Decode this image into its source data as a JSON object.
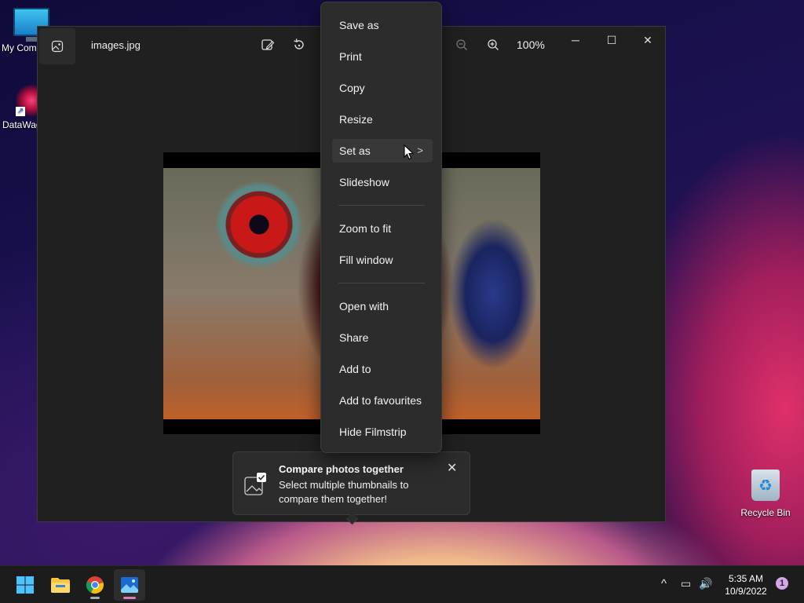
{
  "desktop": {
    "icons": [
      {
        "label": "My Com"
      },
      {
        "label": "DataWag"
      },
      {
        "label": "Recycle Bin"
      }
    ]
  },
  "window": {
    "title": "images.jpg",
    "zoom": "100%",
    "controls": {
      "minimize": "─",
      "maximize": "☐",
      "close": "✕"
    }
  },
  "context_menu": {
    "items": [
      {
        "label": "Save as"
      },
      {
        "label": "Print"
      },
      {
        "label": "Copy"
      },
      {
        "label": "Resize"
      },
      {
        "label": "Set as",
        "submenu": ">"
      },
      {
        "label": "Slideshow"
      },
      {
        "label": "Zoom to fit"
      },
      {
        "label": "Fill window"
      },
      {
        "label": "Open with"
      },
      {
        "label": "Share"
      },
      {
        "label": "Add to"
      },
      {
        "label": "Add to favourites"
      },
      {
        "label": "Hide Filmstrip"
      }
    ]
  },
  "notification": {
    "title": "Compare photos together",
    "body": "Select multiple thumbnails to compare them together!",
    "close": "✕"
  },
  "taskbar": {
    "time": "5:35 AM",
    "date": "10/9/2022",
    "notification_count": "1",
    "tray": {
      "chevron": "^",
      "network": "▭",
      "volume": "🔊"
    }
  },
  "colors": {
    "accent": "#e17ab8",
    "menu_bg": "#2c2c2c",
    "window_bg": "#202020"
  }
}
